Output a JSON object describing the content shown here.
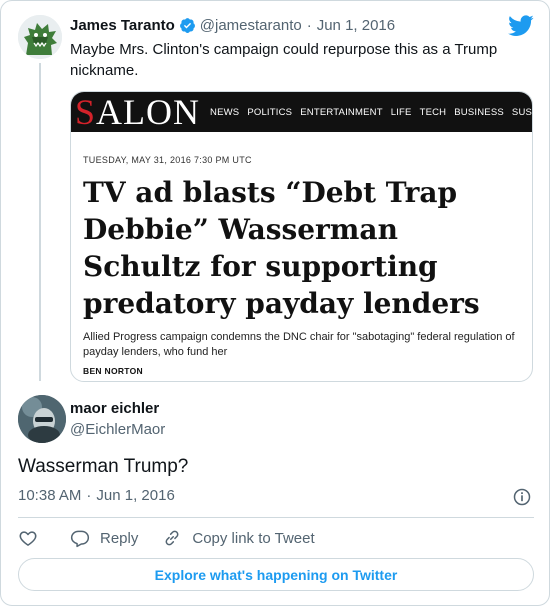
{
  "parent_tweet": {
    "name": "James Taranto",
    "handle": "@jamestaranto",
    "date": "Jun 1, 2016",
    "text": "Maybe Mrs. Clinton's campaign could repurpose this as a Trump nickname.",
    "avatar_icon": "godzilla-avatar",
    "verified_icon": "verified-badge-icon"
  },
  "salon_article": {
    "logo_first": "S",
    "logo_rest": "ALON",
    "nav": [
      "NEWS",
      "POLITICS",
      "ENTERTAINMENT",
      "LIFE",
      "TECH",
      "BUSINESS",
      "SUSTAIN"
    ],
    "date": "TUESDAY, MAY 31, 2016 7:30 PM UTC",
    "headline": "TV ad blasts “Debt Trap Debbie” Wasserman Schultz for supporting predatory payday lenders",
    "subhead": "Allied Progress campaign condemns the DNC chair for \"sabotaging\" federal regulation of payday lenders, who fund her",
    "author": "BEN NORTON"
  },
  "main_tweet": {
    "name": "maor eichler",
    "handle": "@EichlerMaor",
    "text": "Wasserman Trump?",
    "time": "10:38 AM",
    "date": "Jun 1, 2016"
  },
  "actions": {
    "like_icon": "heart-icon",
    "reply_label": "Reply",
    "copy_label": "Copy link to Tweet"
  },
  "explore_label": "Explore what's happening on Twitter",
  "colors": {
    "accent": "#1d9bf0",
    "salon_red": "#d4222a",
    "muted_text": "#536471",
    "border": "#cfd9de"
  }
}
